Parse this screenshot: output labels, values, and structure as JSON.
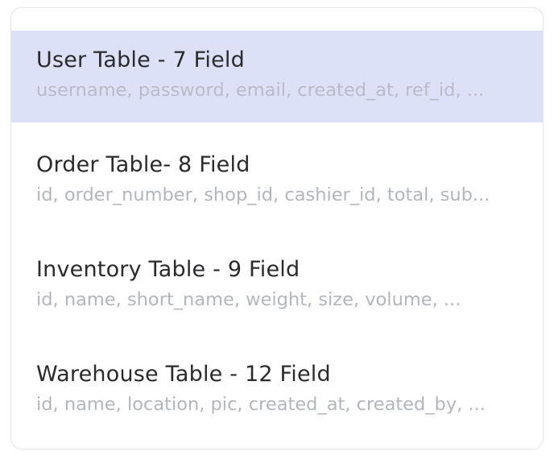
{
  "tables": [
    {
      "title": "User Table - 7 Field",
      "fields": "username, password, email, created_at, ref_id, ...",
      "selected": true
    },
    {
      "title": "Order Table- 8 Field",
      "fields": "id, order_number, shop_id, cashier_id, total, sub...",
      "selected": false
    },
    {
      "title": "Inventory Table - 9 Field",
      "fields": "id, name, short_name, weight, size, volume, ...",
      "selected": false
    },
    {
      "title": "Warehouse Table - 12 Field",
      "fields": "id, name, location, pic, created_at, created_by, ...",
      "selected": false
    }
  ],
  "colors": {
    "selected_bg": "#dde1f8",
    "title_text": "#2b2b2e",
    "fields_text": "#b3b6bd"
  }
}
